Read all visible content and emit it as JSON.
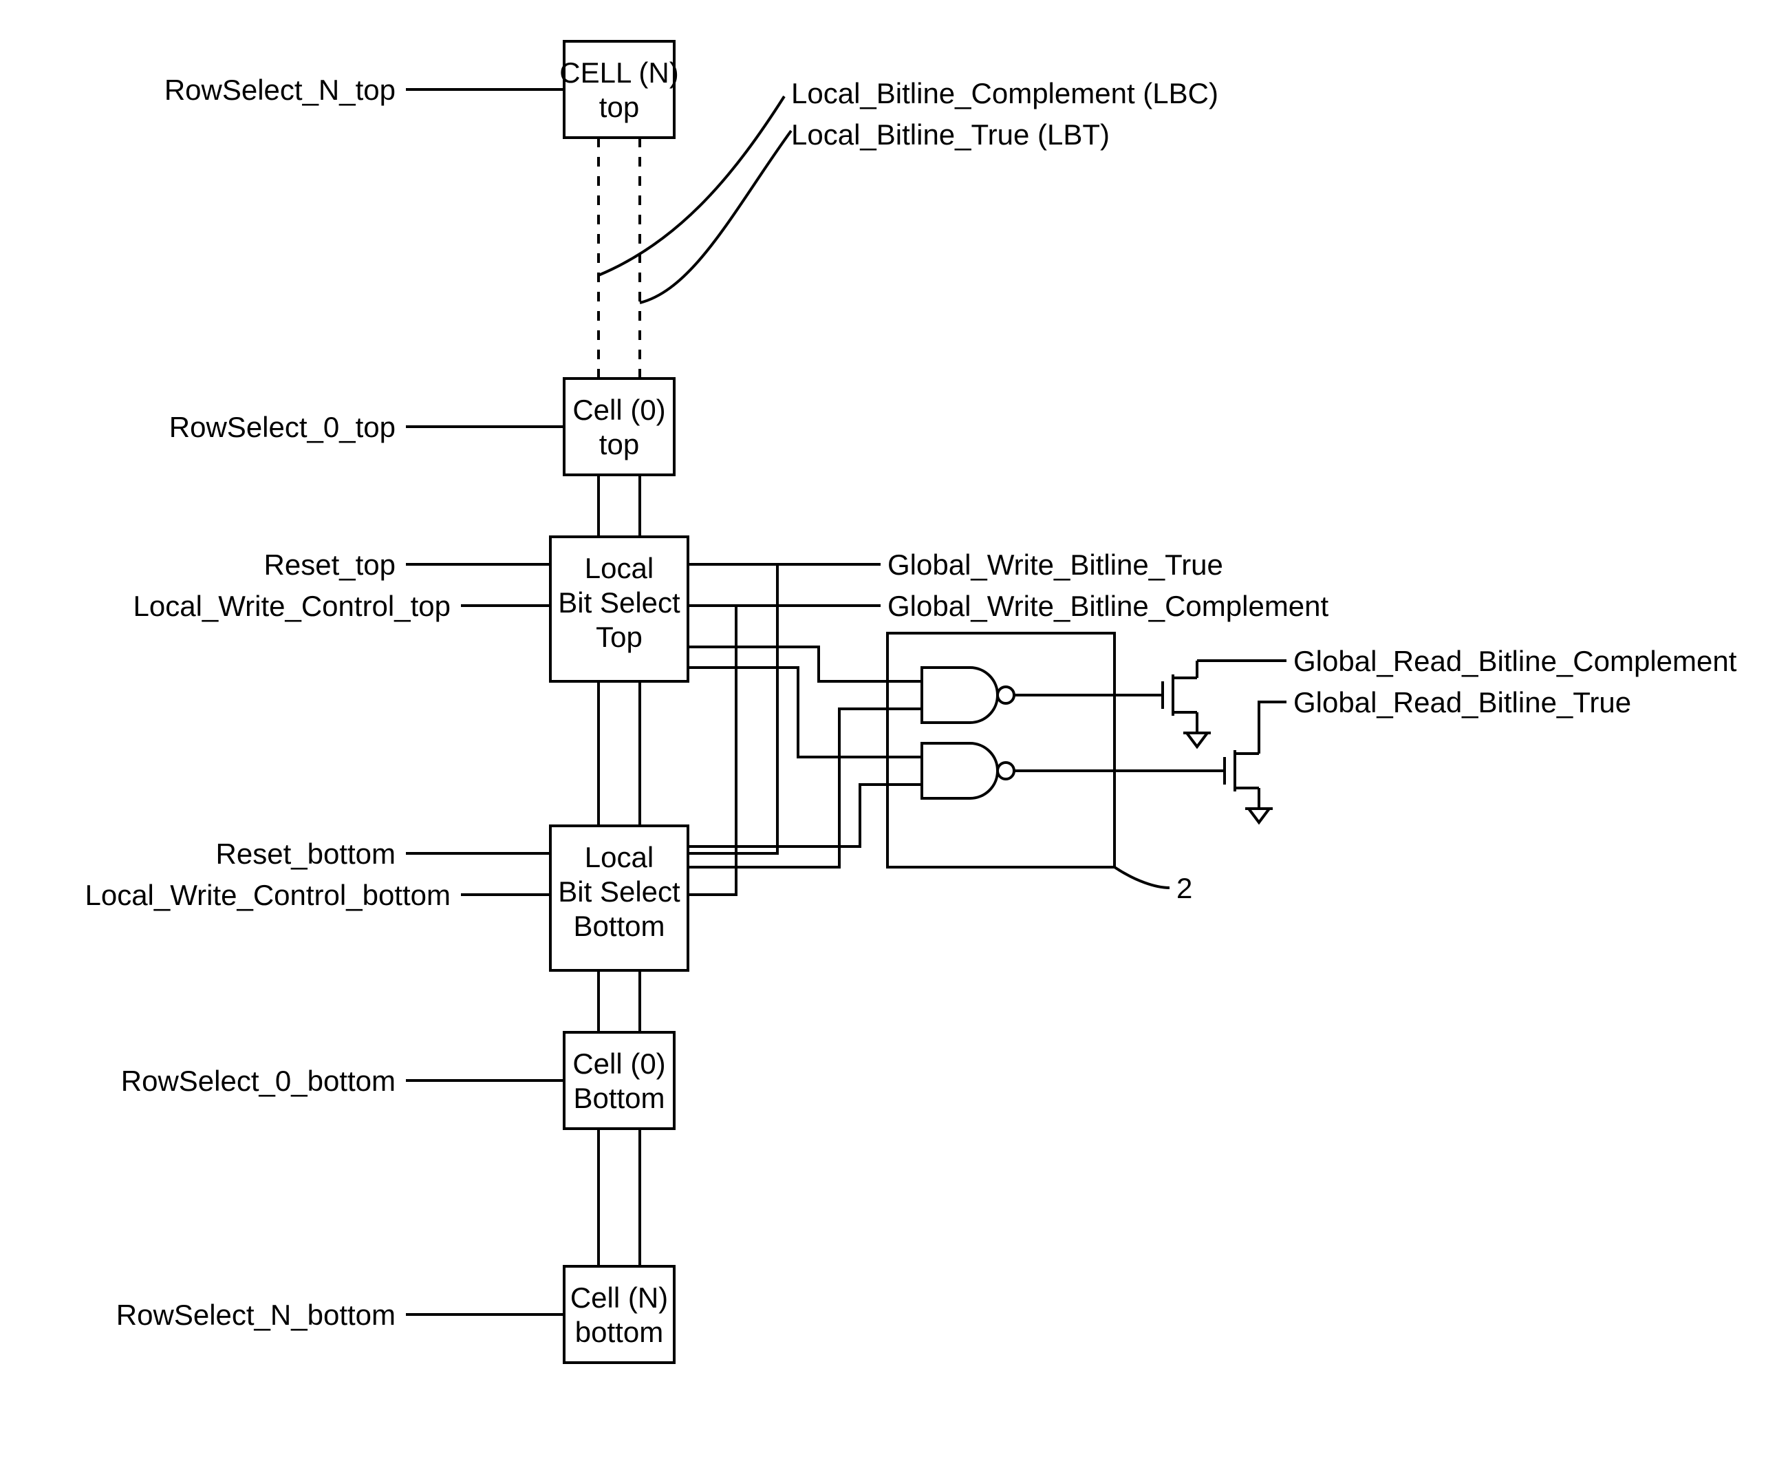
{
  "signals": {
    "rowsel_n_top": "RowSelect_N_top",
    "rowsel_0_top": "RowSelect_0_top",
    "reset_top": "Reset_top",
    "lwc_top": "Local_Write_Control_top",
    "reset_bottom": "Reset_bottom",
    "lwc_bottom": "Local_Write_Control_bottom",
    "rowsel_0_bottom": "RowSelect_0_bottom",
    "rowsel_n_bottom": "RowSelect_N_bottom",
    "lbc": "Local_Bitline_Complement (LBC)",
    "lbt": "Local_Bitline_True (LBT)",
    "gwbt": "Global_Write_Bitline_True",
    "gwbc": "Global_Write_Bitline_Complement",
    "grbc": "Global_Read_Bitline_Complement",
    "grbt": "Global_Read_Bitline_True",
    "ref2": "2"
  },
  "blocks": {
    "cell_n_top_l1": "CELL (N)",
    "cell_n_top_l2": "top",
    "cell_0_top_l1": "Cell (0)",
    "cell_0_top_l2": "top",
    "lbs_top_l1": "Local",
    "lbs_top_l2": "Bit Select",
    "lbs_top_l3": "Top",
    "lbs_bot_l1": "Local",
    "lbs_bot_l2": "Bit Select",
    "lbs_bot_l3": "Bottom",
    "cell_0_bot_l1": "Cell (0)",
    "cell_0_bot_l2": "Bottom",
    "cell_n_bot_l1": "Cell (N)",
    "cell_n_bot_l2": "bottom"
  }
}
